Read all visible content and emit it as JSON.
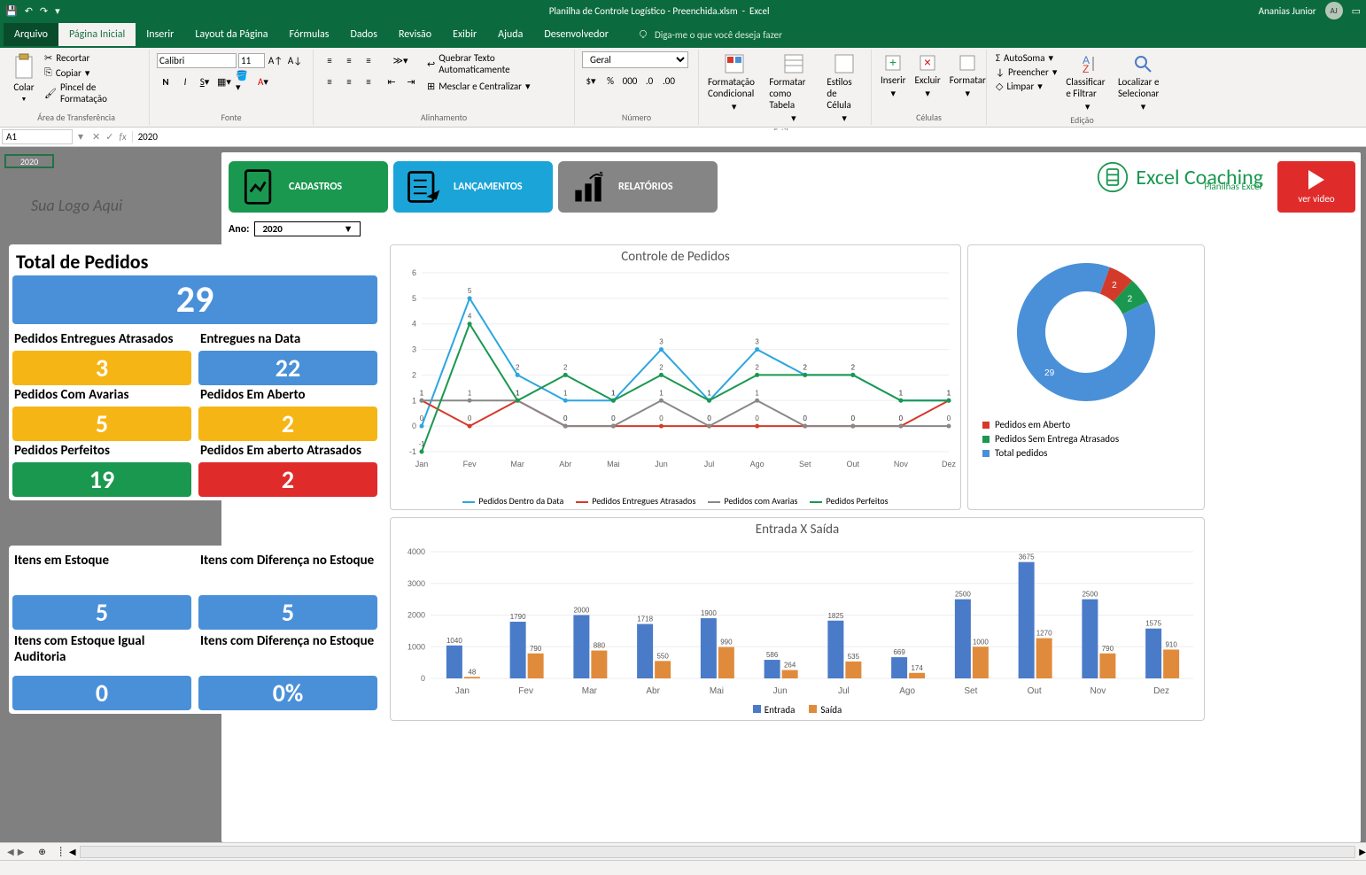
{
  "titlebar": {
    "filename": "Planilha de Controle Logístico - Preenchida.xlsm",
    "app": "Excel",
    "user": "Ananias Junior",
    "avatar": "AJ"
  },
  "tabs": {
    "file": "Arquivo",
    "home": "Página Inicial",
    "insert": "Inserir",
    "layout": "Layout da Página",
    "formulas": "Fórmulas",
    "data": "Dados",
    "review": "Revisão",
    "view": "Exibir",
    "help": "Ajuda",
    "dev": "Desenvolvedor",
    "tellme": "Diga-me o que você deseja fazer"
  },
  "ribbon": {
    "clipboard": {
      "label": "Área de Transferência",
      "paste": "Colar",
      "cut": "Recortar",
      "copy": "Copiar",
      "painter": "Pincel de Formatação"
    },
    "font": {
      "label": "Fonte",
      "name": "Calibri",
      "size": "11"
    },
    "alignment": {
      "label": "Alinhamento",
      "wrap": "Quebrar Texto Automaticamente",
      "merge": "Mesclar e Centralizar"
    },
    "number": {
      "label": "Número",
      "format": "Geral"
    },
    "styles": {
      "label": "Estilos",
      "cond": "Formatação Condicional",
      "table": "Formatar como Tabela",
      "cell": "Estilos de Célula"
    },
    "cells": {
      "label": "Células",
      "insert": "Inserir",
      "delete": "Excluir",
      "format": "Formatar"
    },
    "editing": {
      "label": "Edição",
      "sum": "AutoSoma",
      "fill": "Preencher",
      "clear": "Limpar",
      "sort": "Classificar e Filtrar",
      "find": "Localizar e Selecionar"
    }
  },
  "formula_bar": {
    "cell": "A1",
    "value": "2020"
  },
  "dashboard": {
    "year_cell": "2020",
    "logo_placeholder": "Sua Logo Aqui",
    "nav": {
      "cadastros": "CADASTROS",
      "lancamentos": "LANÇAMENTOS",
      "relatorios": "RELATÓRIOS"
    },
    "brand": {
      "name": "Excel Coaching",
      "sub": "Planilhas Excel"
    },
    "video": "ver video",
    "ano_label": "Ano:",
    "ano_value": "2020"
  },
  "kpi": {
    "total_label": "Total de Pedidos",
    "total_val": "29",
    "atrasados_label": "Pedidos Entregues Atrasados",
    "atrasados_val": "3",
    "nadata_label": "Entregues na Data",
    "nadata_val": "22",
    "avarias_label": "Pedidos Com Avarias",
    "avarias_val": "5",
    "aberto_label": "Pedidos Em Aberto",
    "aberto_val": "2",
    "perfeitos_label": "Pedidos Perfeitos",
    "perfeitos_val": "19",
    "aberto_atr_label": "Pedidos Em aberto Atrasados",
    "aberto_atr_val": "2",
    "itens_estoque_label": "Itens em Estoque",
    "itens_estoque_val": "5",
    "itens_dif_label": "Itens com Diferença no Estoque",
    "itens_dif_val": "5",
    "itens_aud_label": "Itens com Estoque Igual Auditoria",
    "itens_aud_val": "0",
    "itens_dif2_label": "Itens com Diferença no Estoque",
    "itens_dif2_val": "0%"
  },
  "chart_data": [
    {
      "id": "controle_pedidos",
      "type": "line",
      "title": "Controle de Pedidos",
      "categories": [
        "Jan",
        "Fev",
        "Mar",
        "Abr",
        "Mai",
        "Jun",
        "Jul",
        "Ago",
        "Set",
        "Out",
        "Nov",
        "Dez"
      ],
      "ylim": [
        -1,
        6
      ],
      "series": [
        {
          "name": "Pedidos Dentro da Data",
          "color": "#2ca6e0",
          "values": [
            0,
            5,
            2,
            1,
            1,
            3,
            1,
            3,
            2,
            2,
            1,
            1
          ]
        },
        {
          "name": "Pedidos Entregues Atrasados",
          "color": "#d43a2a",
          "values": [
            1,
            0,
            1,
            0,
            0,
            0,
            0,
            0,
            0,
            0,
            0,
            1
          ]
        },
        {
          "name": "Pedidos com Avarias",
          "color": "#888888",
          "values": [
            1,
            1,
            1,
            0,
            0,
            1,
            0,
            1,
            0,
            0,
            0,
            0
          ]
        },
        {
          "name": "Pedidos Perfeitos",
          "color": "#1a9850",
          "values": [
            -1,
            4,
            1,
            2,
            1,
            2,
            1,
            2,
            2,
            2,
            1,
            1
          ]
        }
      ]
    },
    {
      "id": "donut",
      "type": "pie",
      "series": [
        {
          "name": "Pedidos em Aberto",
          "color": "#d43a2a",
          "value": 2
        },
        {
          "name": "Pedidos Sem Entrega Atrasados",
          "color": "#1a9850",
          "value": 2
        },
        {
          "name": "Total pedidos",
          "color": "#4a90d9",
          "value": 29
        }
      ]
    },
    {
      "id": "entrada_saida",
      "type": "bar",
      "title": "Entrada X Saída",
      "ylim": [
        0,
        4000
      ],
      "categories": [
        "Jan",
        "Fev",
        "Mar",
        "Abr",
        "Mai",
        "Jun",
        "Jul",
        "Ago",
        "Set",
        "Out",
        "Nov",
        "Dez"
      ],
      "series": [
        {
          "name": "Entrada",
          "color": "#4a7bc8",
          "values": [
            1040,
            1790,
            2000,
            1718,
            1900,
            586,
            1825,
            669,
            2500,
            3675,
            2500,
            1575
          ]
        },
        {
          "name": "Saída",
          "color": "#e08b3c",
          "values": [
            48,
            790,
            880,
            550,
            990,
            264,
            535,
            174,
            1000,
            1270,
            790,
            910
          ]
        }
      ]
    }
  ]
}
